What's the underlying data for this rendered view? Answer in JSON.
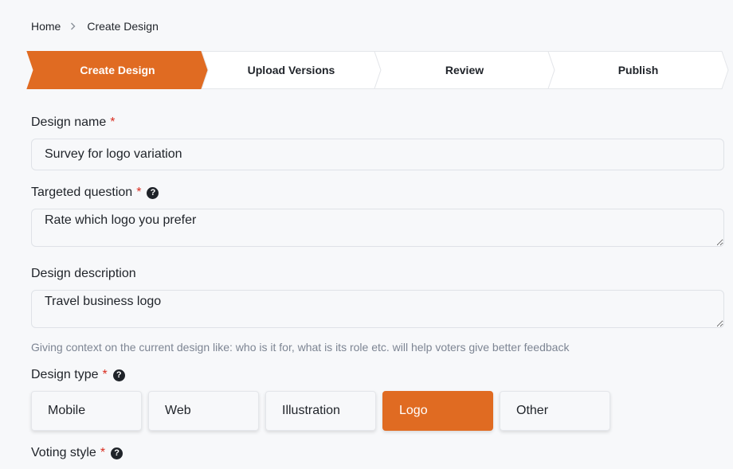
{
  "breadcrumb": {
    "home": "Home",
    "current": "Create Design"
  },
  "steps": [
    {
      "label": "Create Design",
      "active": true
    },
    {
      "label": "Upload Versions",
      "active": false
    },
    {
      "label": "Review",
      "active": false
    },
    {
      "label": "Publish",
      "active": false
    }
  ],
  "form": {
    "name_label": "Design name",
    "name_value": "Survey for logo variation",
    "question_label": "Targeted question",
    "question_value": "Rate which logo you prefer",
    "description_label": "Design description",
    "description_value": "Travel business logo",
    "description_hint": "Giving context on the current design like: who is it for, what is its role etc. will help voters give better feedback",
    "type_label": "Design type",
    "types": [
      "Mobile",
      "Web",
      "Illustration",
      "Logo",
      "Other"
    ],
    "selected_type": "Logo",
    "voting_label": "Voting style",
    "required_mark": "*",
    "help_mark": "?"
  },
  "colors": {
    "accent": "#e06b22",
    "required": "#d92d20",
    "border": "#dfe2e7"
  },
  "icons": {
    "breadcrumb_separator": "chevron-right-icon",
    "help": "question-circle-icon"
  }
}
